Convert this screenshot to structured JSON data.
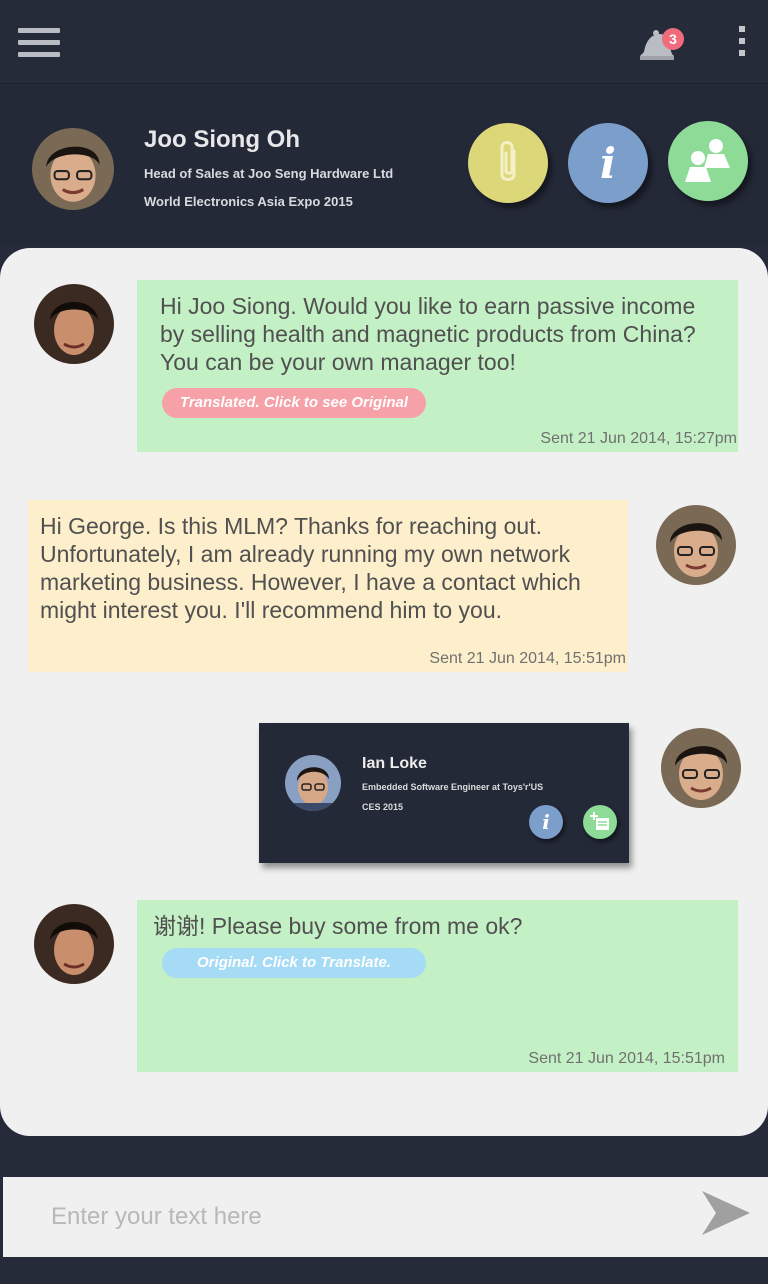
{
  "topbar": {
    "menu_icon": "hamburger-menu-icon",
    "notification_icon": "bell-icon",
    "notification_count": "3",
    "more_icon": "vertical-dots-icon"
  },
  "profile": {
    "name": "Joo Siong Oh",
    "title": "Head of Sales at Joo Seng Hardware Ltd",
    "event": "World Electronics Asia Expo 2015",
    "actions": [
      {
        "icon": "paperclip-icon",
        "color": "#dcd778"
      },
      {
        "icon": "info-icon",
        "color": "#7c9ecb"
      },
      {
        "icon": "people-icon",
        "color": "#8edb98"
      }
    ]
  },
  "messages": [
    {
      "text": "Hi Joo Siong. Would you like to earn passive income by selling health and magnetic products from China? You can be your own manager too!",
      "pill": "Translated. Click to see Original",
      "time": "Sent 21 Jun 2014, 15:27pm",
      "color": "#c4f0c6"
    },
    {
      "text": "Hi George. Is this MLM? Thanks for reaching out. Unfortunately, I am already running my own network marketing business. However, I have a contact which might interest you. I'll recommend him to you.",
      "time": "Sent 21 Jun 2014, 15:51pm",
      "color": "#fdefcc"
    },
    {
      "card": {
        "name": "Ian Loke",
        "title": "Embedded Software Engineer at Toys'r'US",
        "event": "CES 2015"
      }
    },
    {
      "text": "谢谢! Please buy some from me ok?",
      "pill": "Original. Click to Translate.",
      "time": "Sent 21 Jun 2014, 15:51pm",
      "color": "#c4f0c6"
    }
  ],
  "composer": {
    "placeholder": "Enter your text here",
    "send_icon": "send-arrow-icon"
  },
  "colors": {
    "dark_bg": "#262b39",
    "chat_bg": "#f0f0f0",
    "translated_pill": "#f6a0a8",
    "original_pill": "#a6dbf5"
  }
}
